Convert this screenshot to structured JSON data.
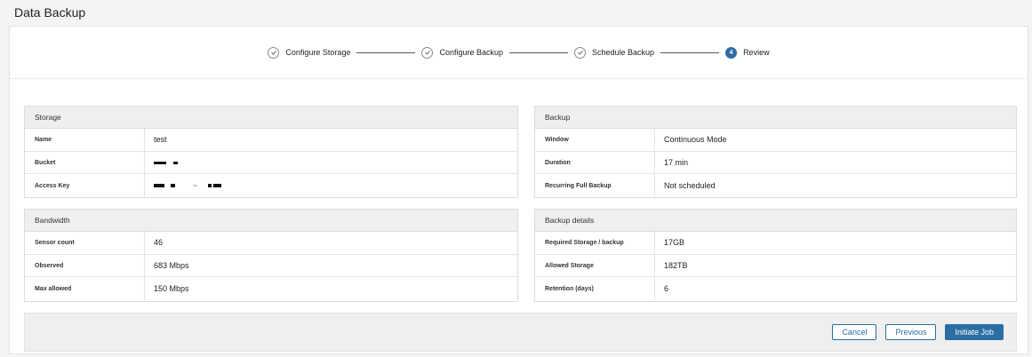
{
  "page": {
    "title": "Data Backup"
  },
  "stepper": {
    "steps": [
      {
        "label": "Configure Storage",
        "state": "done"
      },
      {
        "label": "Configure Backup",
        "state": "done"
      },
      {
        "label": "Schedule Backup",
        "state": "done"
      },
      {
        "label": "Review",
        "state": "active",
        "number": "4"
      }
    ]
  },
  "storage": {
    "title": "Storage",
    "rows": [
      {
        "key": "Name",
        "value": "test"
      },
      {
        "key": "Bucket",
        "value": ""
      },
      {
        "key": "Access Key",
        "value": ""
      }
    ]
  },
  "backup": {
    "title": "Backup",
    "rows": [
      {
        "key": "Window",
        "value": "Continuous Mode"
      },
      {
        "key": "Duration",
        "value": "17 min"
      },
      {
        "key": "Recurring Full Backup",
        "value": "Not scheduled"
      }
    ]
  },
  "bandwidth": {
    "title": "Bandwidth",
    "rows": [
      {
        "key": "Sensor count",
        "value": "46"
      },
      {
        "key": "Observed",
        "value": "683 Mbps"
      },
      {
        "key": "Max allowed",
        "value": "150 Mbps"
      }
    ]
  },
  "backup_details": {
    "title": "Backup details",
    "rows": [
      {
        "key": "Required Storage / backup",
        "value": "17GB"
      },
      {
        "key": "Allowed Storage",
        "value": "182TB"
      },
      {
        "key": "Retention (days)",
        "value": "6"
      }
    ]
  },
  "footer": {
    "cancel_label": "Cancel",
    "previous_label": "Previous",
    "initiate_label": "Initiate Job"
  },
  "colors": {
    "accent": "#2b6ea3",
    "panel_header": "#efefef"
  }
}
